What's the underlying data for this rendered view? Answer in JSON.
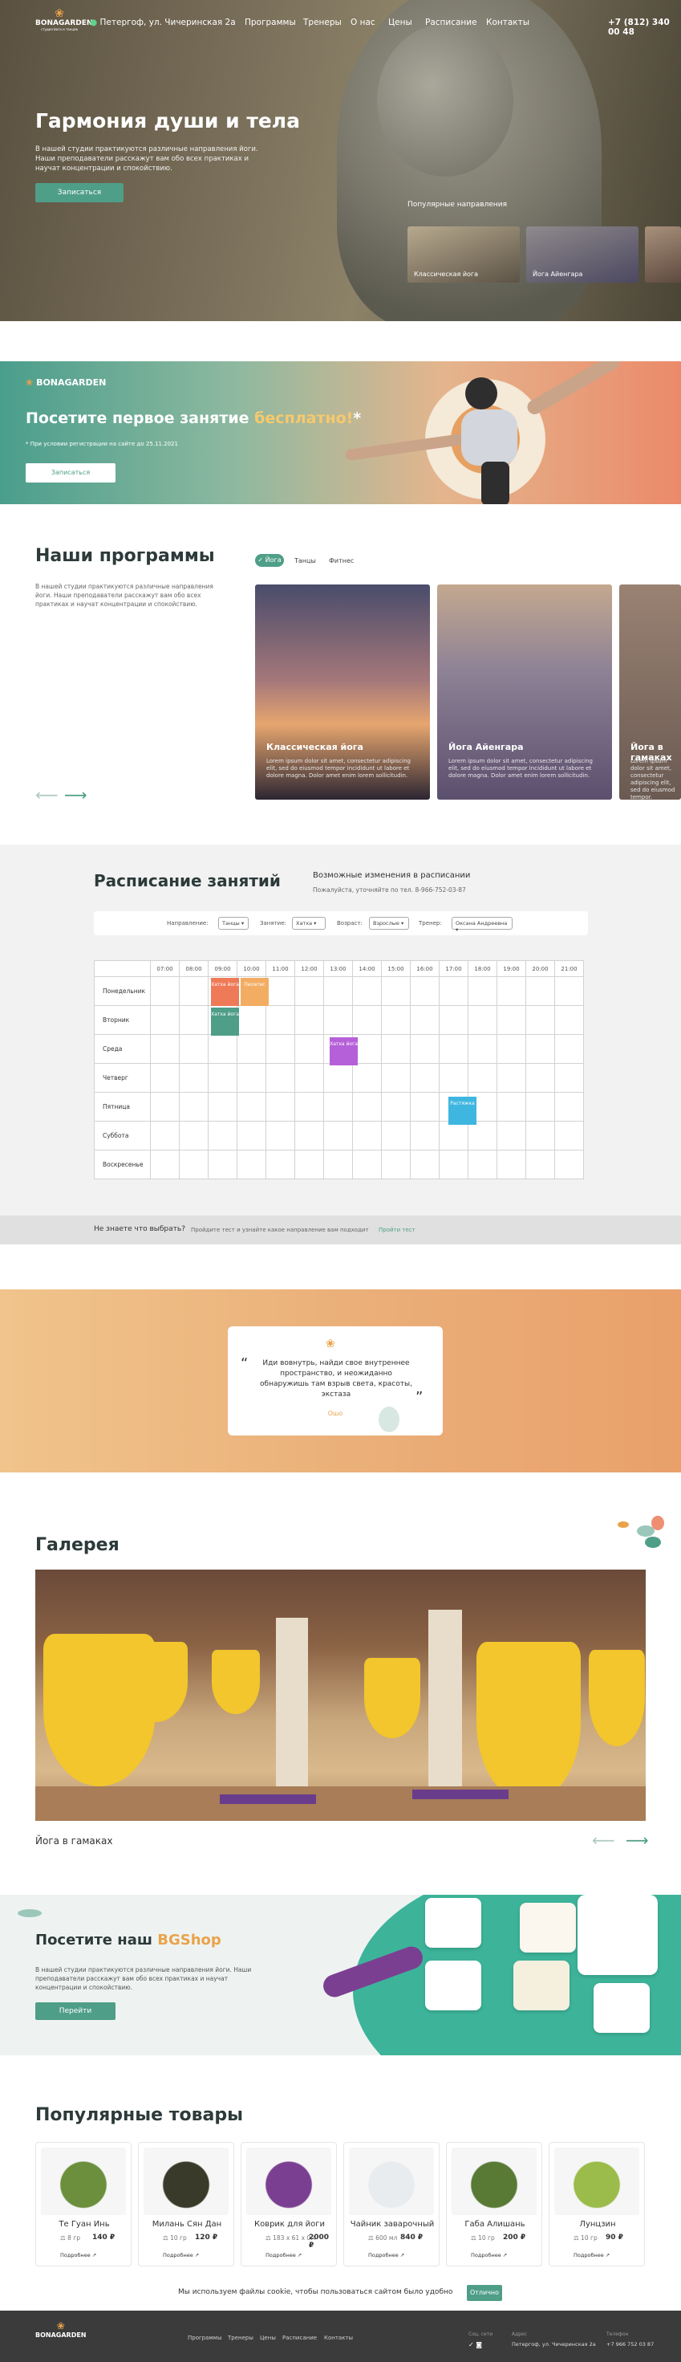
{
  "header": {
    "logo_text": "BONAGARDEN",
    "logo_sub": "студия йоги и танцев",
    "address": "Петергоф, ул. Чичеринская 2а",
    "nav": [
      "Программы",
      "Тренеры",
      "О нас",
      "Цены",
      "Расписание",
      "Контакты"
    ],
    "phone": "+7 (812) 340 00 48"
  },
  "hero": {
    "title": "Гармония души и тела",
    "text": "В нашей студии практикуются различные направления йоги. Наши преподаватели расскажут вам обо всех практиках и научат концентрации и спокойствию.",
    "button": "Записаться",
    "popular_title": "Популярные направления",
    "thumbs": [
      "Классическая йога",
      "Йога Айенгара"
    ]
  },
  "promo": {
    "logo_text": "BONAGARDEN",
    "title_part1": "Посетите первое занятие ",
    "title_highlight": "бесплатно!",
    "title_star": "*",
    "note": "* При условии регистрации на сайте до 25.11.2021",
    "button": "Записаться"
  },
  "programs": {
    "title": "Наши программы",
    "text": "В нашей студии практикуются различные направления йоги. Наши преподаватели расскажут вам обо всех практиках и научат концентрации и спокойствию.",
    "tabs": [
      "Йога",
      "Танцы",
      "Фитнес"
    ],
    "cards": [
      {
        "title": "Классическая йога",
        "desc": "Lorem ipsum dolor sit amet, consectetur adipiscing elit, sed do eiusmod tempor incididunt ut labore et dolore magna. Dolor amet enim lorem sollicitudin."
      },
      {
        "title": "Йога Айенгара",
        "desc": "Lorem ipsum dolor sit amet, consectetur adipiscing elit, sed do eiusmod tempor incididunt ut labore et dolore magna. Dolor amet enim lorem sollicitudin."
      },
      {
        "title": "Йога в гамаках",
        "desc": "Lorem ipsum dolor sit amet, consectetur adipiscing elit, sed do eiusmod tempor."
      }
    ]
  },
  "schedule": {
    "title": "Расписание занятий",
    "changes_title": "Возможные изменения в расписании",
    "changes_text": "Пожалуйста, уточняйте по тел. 8-966-752-03-87",
    "filters": [
      {
        "label": "Направление:",
        "value": "Танцы"
      },
      {
        "label": "Занятие:",
        "value": "Хатха"
      },
      {
        "label": "Возраст:",
        "value": "Взрослые"
      },
      {
        "label": "Тренер:",
        "value": "Оксана Андреевна"
      }
    ],
    "hours": [
      "07:00",
      "08:00",
      "09:00",
      "10:00",
      "11:00",
      "12:00",
      "13:00",
      "14:00",
      "15:00",
      "16:00",
      "17:00",
      "18:00",
      "19:00",
      "20:00",
      "21:00"
    ],
    "days": [
      "Понедельник",
      "Вторник",
      "Среда",
      "Четверг",
      "Пятница",
      "Суббота",
      "Воскресенье"
    ],
    "events": [
      {
        "day": 0,
        "hour": 2,
        "text": "Хатха йога",
        "color": "#ef7a57"
      },
      {
        "day": 0,
        "hour": 3,
        "text": "Пилатес",
        "color": "#f3ad62"
      },
      {
        "day": 1,
        "hour": 2,
        "text": "Хатха йога",
        "color": "#4f9e87"
      },
      {
        "day": 2,
        "hour": 6,
        "text": "Хатха йога",
        "color": "#b560d8"
      },
      {
        "day": 4,
        "hour": 10,
        "text": "Растяжка",
        "color": "#3fb6e0"
      }
    ],
    "help_title": "Не знаете что выбрать?",
    "help_text": "Пройдите тест и узнайте какое направление вам подходит",
    "help_link": "Пройти тест"
  },
  "quote": {
    "text": "Иди вовнутрь, найди свое внутреннее пространство, и неожиданно обнаружишь там взрыв света, красоты, экстаза",
    "author": "Ошо"
  },
  "gallery": {
    "title": "Галерея",
    "caption": "Йога в гамаках"
  },
  "shop": {
    "title_part1": "Посетите наш ",
    "title_highlight": "BGShop",
    "text": "В нашей студии практикуются различные направления йоги. Наши преподаватели расскажут вам обо всех практиках и научат концентрации и спокойствию.",
    "button": "Перейти"
  },
  "products": {
    "title": "Популярные товары",
    "items": [
      {
        "name": "Те Гуан Инь",
        "weight": "8 гр",
        "price": "140 ₽",
        "link": "Подробнее"
      },
      {
        "name": "Милань Сян Дан",
        "weight": "10 гр",
        "price": "120 ₽",
        "link": "Подробнее"
      },
      {
        "name": "Коврик для йоги",
        "weight": "183 x 61 x 0.4",
        "price": "2000 ₽",
        "link": "Подробнее"
      },
      {
        "name": "Чайник заварочный",
        "weight": "600 мл",
        "price": "840 ₽",
        "link": "Подробнее"
      },
      {
        "name": "Габа Алишань",
        "weight": "10 гр",
        "price": "200 ₽",
        "link": "Подробнее"
      },
      {
        "name": "Лунцзин",
        "weight": "10 гр",
        "price": "90 ₽",
        "link": "Подробнее"
      }
    ]
  },
  "cookie": {
    "text": "Мы используем файлы cookie, чтобы пользоваться сайтом было удобно",
    "button": "Отлично"
  },
  "footer": {
    "logo_text": "BONAGARDEN",
    "links": [
      "Программы",
      "Тренеры",
      "Цены",
      "Расписание",
      "Контакты"
    ],
    "social_title": "Соц. сети",
    "address_title": "Адрес",
    "address": "Петергоф, ул. Чичеринская 2а",
    "phone_title": "Телефон",
    "phone": "+7 966 752 03 87"
  }
}
